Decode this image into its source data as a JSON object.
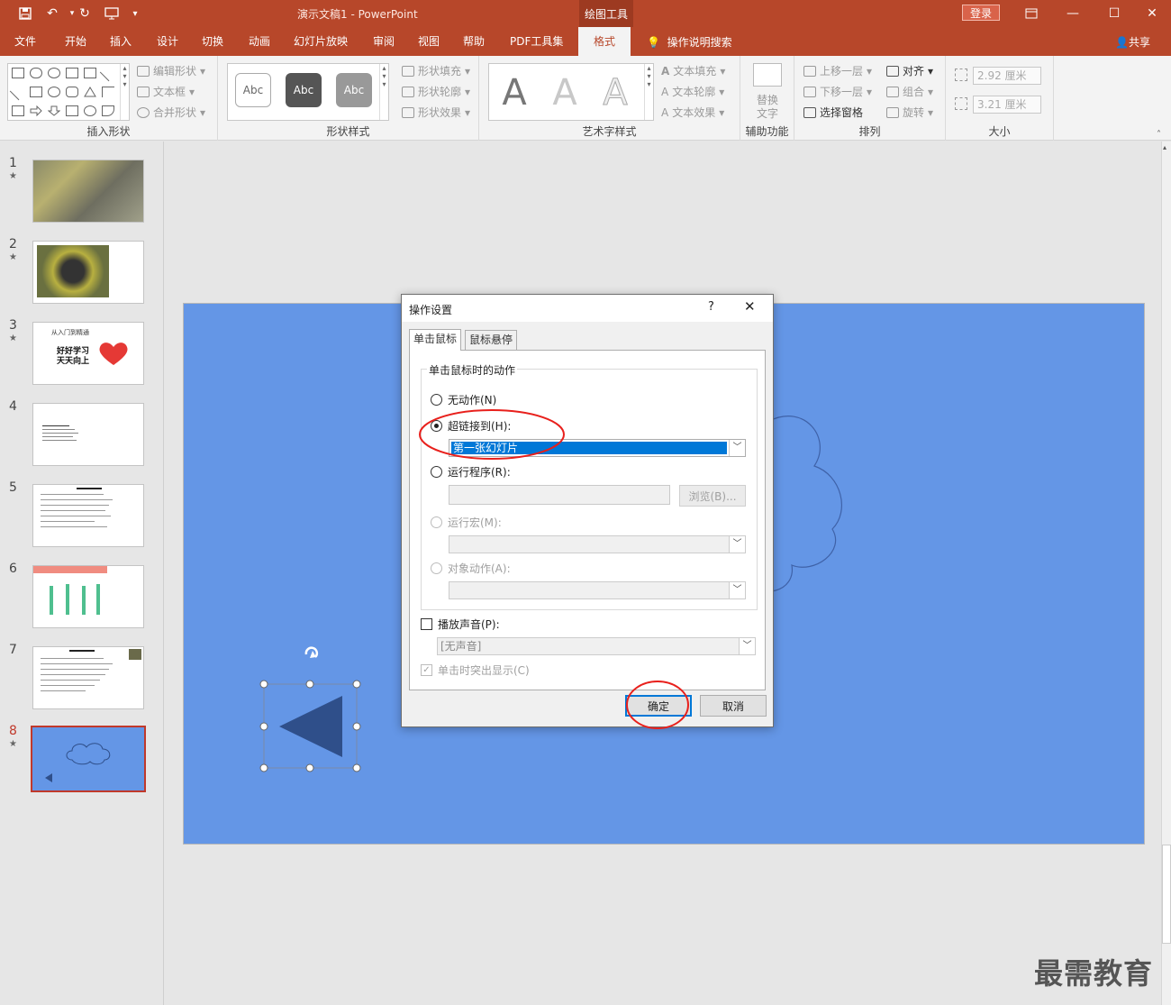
{
  "app": {
    "title": "演示文稿1  -  PowerPoint",
    "tool_tab": "绘图工具",
    "login_label": "登录",
    "accent": "#b7472a"
  },
  "tabs": [
    {
      "label": "文件"
    },
    {
      "label": "开始"
    },
    {
      "label": "插入"
    },
    {
      "label": "设计"
    },
    {
      "label": "切换"
    },
    {
      "label": "动画"
    },
    {
      "label": "幻灯片放映"
    },
    {
      "label": "审阅"
    },
    {
      "label": "视图"
    },
    {
      "label": "帮助"
    },
    {
      "label": "PDF工具集"
    },
    {
      "label": "格式"
    }
  ],
  "search_label": "操作说明搜索",
  "share_label": "共享",
  "ribbon": {
    "insert_shapes": {
      "label": "插入形状",
      "edit_shape": "编辑形状",
      "textbox": "文本框",
      "merge": "合并形状"
    },
    "shape_styles": {
      "label": "形状样式",
      "sample": "Abc",
      "fill": "形状填充",
      "outline": "形状轮廓",
      "effect": "形状效果"
    },
    "art_styles": {
      "label": "艺术字样式",
      "sample": "A",
      "fill": "文本填充",
      "outline": "文本轮廓",
      "effect": "文本效果"
    },
    "accessibility": {
      "label": "辅助功能",
      "alt_text_1": "替换",
      "alt_text_2": "文字"
    },
    "arrange": {
      "label": "排列",
      "bring_forward": "上移一层",
      "send_backward": "下移一层",
      "selection_pane": "选择窗格",
      "align": "对齐",
      "group": "组合",
      "rotate": "旋转"
    },
    "size": {
      "label": "大小",
      "height": "2.92 厘米",
      "width": "3.21 厘米"
    }
  },
  "thumbnails": [
    {
      "num": "1",
      "star": "★"
    },
    {
      "num": "2",
      "star": "★"
    },
    {
      "num": "3",
      "star": "★",
      "text_top": "从入门到精通",
      "text_1": "好好学习",
      "text_2": "天天向上"
    },
    {
      "num": "4",
      "star": ""
    },
    {
      "num": "5",
      "star": ""
    },
    {
      "num": "6",
      "star": ""
    },
    {
      "num": "7",
      "star": ""
    },
    {
      "num": "8",
      "star": "★"
    }
  ],
  "dialog": {
    "title": "操作设置",
    "help": "?",
    "close": "✕",
    "tabs": [
      "单击鼠标",
      "鼠标悬停"
    ],
    "group_label": "单击鼠标时的动作",
    "no_action": "无动作(N)",
    "hyperlink": "超链接到(H):",
    "hyperlink_value": "第一张幻灯片",
    "run_program": "运行程序(R):",
    "browse": "浏览(B)...",
    "run_macro": "运行宏(M):",
    "object_action": "对象动作(A):",
    "play_sound": "播放声音(P):",
    "sound_value": "[无声音]",
    "highlight": "单击时突出显示(C)",
    "ok": "确定",
    "cancel": "取消"
  },
  "watermark": "最需教育",
  "colors": {
    "slide_bg": "#6496e6",
    "shape_fill": "#2f4f8a",
    "annotation": "#e8201c"
  }
}
